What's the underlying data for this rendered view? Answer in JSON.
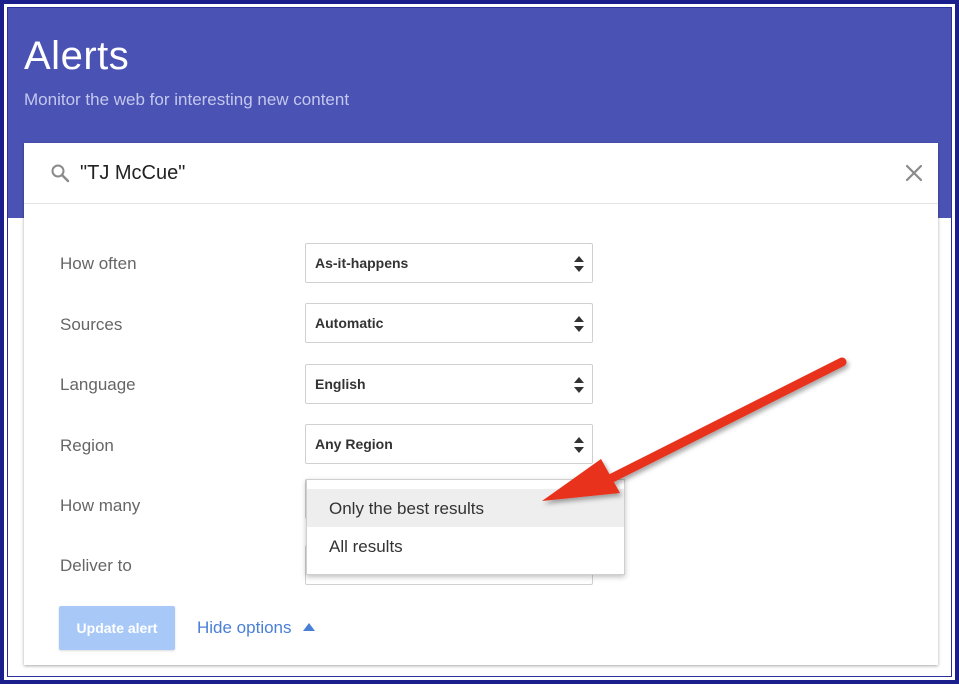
{
  "header": {
    "title": "Alerts",
    "subtitle": "Monitor the web for interesting new content",
    "background_color": "#4a52b4"
  },
  "search": {
    "value": "\"TJ McCue\"",
    "icon": "search-icon",
    "clear_icon": "close-icon"
  },
  "options": [
    {
      "label": "How often",
      "value": "As-it-happens"
    },
    {
      "label": "Sources",
      "value": "Automatic"
    },
    {
      "label": "Language",
      "value": "English"
    },
    {
      "label": "Region",
      "value": "Any Region"
    },
    {
      "label": "How many",
      "value": ""
    },
    {
      "label": "Deliver to",
      "value": ""
    }
  ],
  "how_many_dropdown": {
    "items": [
      "Only the best results",
      "All results"
    ],
    "highlighted_index": 0
  },
  "actions": {
    "update_label": "Update alert",
    "hide_options_label": "Hide options"
  },
  "annotation": {
    "arrow_color": "#e8321f"
  }
}
